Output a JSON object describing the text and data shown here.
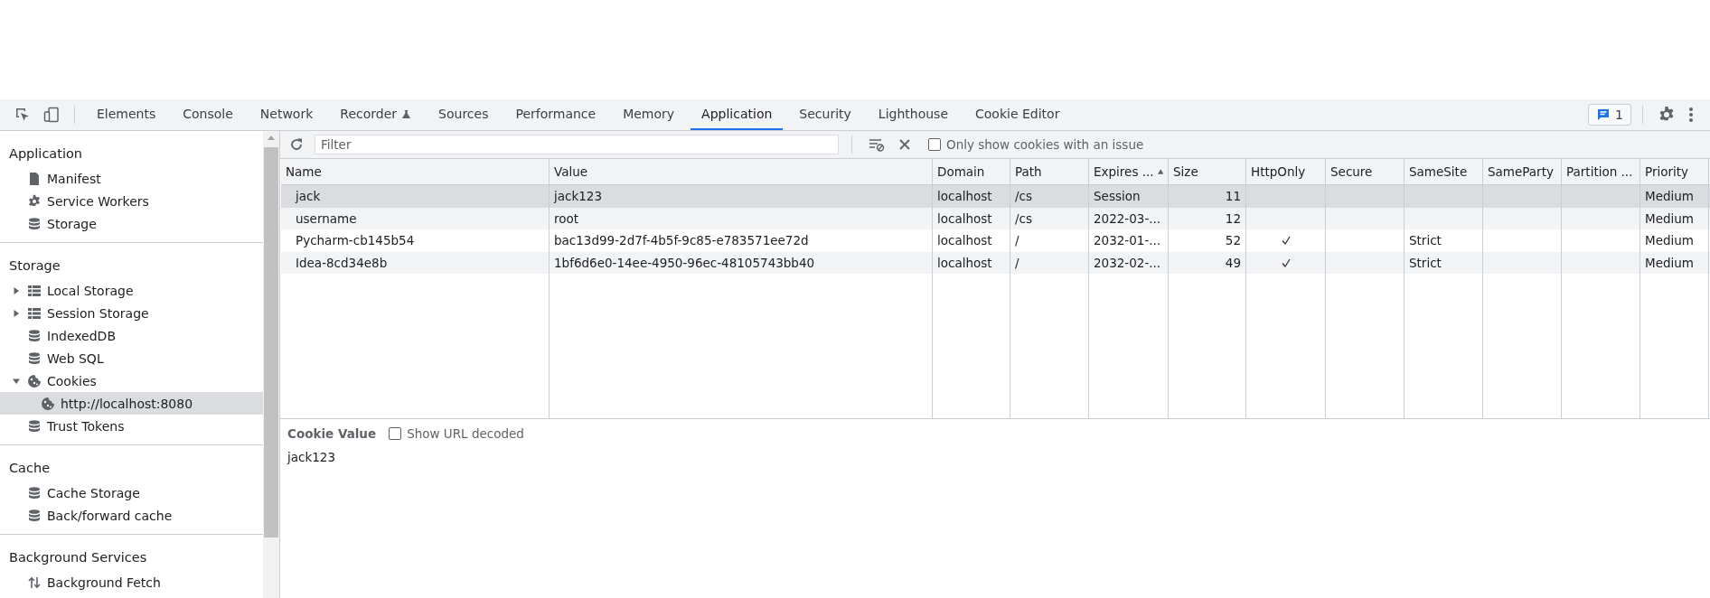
{
  "tabs": [
    {
      "label": "Elements",
      "selected": false
    },
    {
      "label": "Console",
      "selected": false
    },
    {
      "label": "Network",
      "selected": false
    },
    {
      "label": "Recorder",
      "selected": false,
      "kind": "flask"
    },
    {
      "label": "Sources",
      "selected": false
    },
    {
      "label": "Performance",
      "selected": false
    },
    {
      "label": "Memory",
      "selected": false
    },
    {
      "label": "Application",
      "selected": true
    },
    {
      "label": "Security",
      "selected": false
    },
    {
      "label": "Lighthouse",
      "selected": false
    },
    {
      "label": "Cookie Editor",
      "selected": false
    }
  ],
  "issues_badge": "1",
  "sidebar": {
    "sections": [
      {
        "title": "Application",
        "items": [
          {
            "label": "Manifest",
            "kind": "file",
            "selected": false
          },
          {
            "label": "Service Workers",
            "kind": "gear",
            "selected": false
          },
          {
            "label": "Storage",
            "kind": "database",
            "selected": false
          }
        ]
      },
      {
        "title": "Storage",
        "items": [
          {
            "label": "Local Storage",
            "kind": "grid",
            "selected": false,
            "expanded": false
          },
          {
            "label": "Session Storage",
            "kind": "grid",
            "selected": false,
            "expanded": false
          },
          {
            "label": "IndexedDB",
            "kind": "database",
            "selected": false
          },
          {
            "label": "Web SQL",
            "kind": "database",
            "selected": false
          },
          {
            "label": "Cookies",
            "kind": "cookie",
            "selected": false,
            "expanded": true,
            "children": [
              {
                "label": "http://localhost:8080",
                "kind": "cookie",
                "selected": true
              }
            ]
          },
          {
            "label": "Trust Tokens",
            "kind": "database",
            "selected": false
          }
        ]
      },
      {
        "title": "Cache",
        "items": [
          {
            "label": "Cache Storage",
            "kind": "database",
            "selected": false
          },
          {
            "label": "Back/forward cache",
            "kind": "database",
            "selected": false
          }
        ]
      },
      {
        "title": "Background Services",
        "items": [
          {
            "label": "Background Fetch",
            "kind": "fetch",
            "selected": false
          }
        ]
      }
    ]
  },
  "toolbar": {
    "filter_placeholder": "Filter",
    "only_issues": {
      "label": "Only show cookies with an issue",
      "checked": false
    }
  },
  "table": {
    "columns": [
      {
        "label": "Name",
        "kind": "text"
      },
      {
        "label": "Value",
        "kind": "text"
      },
      {
        "label": "Domain",
        "kind": "text"
      },
      {
        "label": "Path",
        "kind": "text"
      },
      {
        "label": "Expires ...",
        "kind": "text",
        "sorted_ascending": true
      },
      {
        "label": "Size",
        "kind": "number"
      },
      {
        "label": "HttpOnly",
        "kind": "check"
      },
      {
        "label": "Secure",
        "kind": "text"
      },
      {
        "label": "SameSite",
        "kind": "text"
      },
      {
        "label": "SameParty",
        "kind": "text"
      },
      {
        "label": "Partition ...",
        "kind": "text"
      },
      {
        "label": "Priority",
        "kind": "text"
      }
    ],
    "rows": [
      {
        "selected": true,
        "cells": [
          "jack",
          "jack123",
          "localhost",
          "/cs",
          "Session",
          "11",
          false,
          null,
          null,
          null,
          null,
          "Medium"
        ]
      },
      {
        "selected": false,
        "cells": [
          "username",
          "root",
          "localhost",
          "/cs",
          "2022-03-...",
          "12",
          false,
          null,
          null,
          null,
          null,
          "Medium"
        ]
      },
      {
        "selected": false,
        "cells": [
          "Pycharm-cb145b54",
          "bac13d99-2d7f-4b5f-9c85-e783571ee72d",
          "localhost",
          "/",
          "2032-01-...",
          "52",
          true,
          null,
          "Strict",
          null,
          null,
          "Medium"
        ]
      },
      {
        "selected": false,
        "cells": [
          "Idea-8cd34e8b",
          "1bf6d6e0-14ee-4950-96ec-48105743bb40",
          "localhost",
          "/",
          "2032-02-...",
          "49",
          true,
          null,
          "Strict",
          null,
          null,
          "Medium"
        ]
      }
    ]
  },
  "cookie_value": {
    "title": "Cookie Value",
    "url_decoded": {
      "label": "Show URL decoded",
      "checked": false
    },
    "value": "jack123"
  }
}
